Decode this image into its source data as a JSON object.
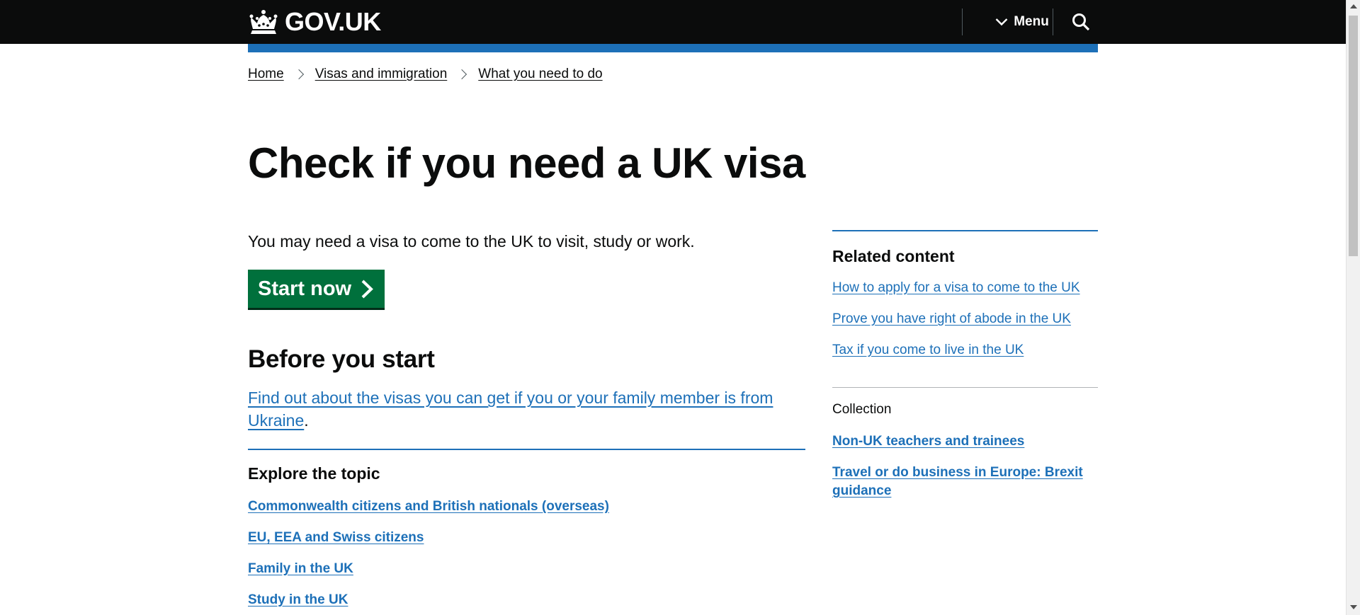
{
  "header": {
    "logo_text": "GOV.UK",
    "menu_label": "Menu",
    "colors": {
      "background": "#0b0c0c",
      "accent_bar": "#1d70b8"
    }
  },
  "breadcrumbs": [
    {
      "label": "Home"
    },
    {
      "label": "Visas and immigration"
    },
    {
      "label": "What you need to do"
    }
  ],
  "page": {
    "title": "Check if you need a UK visa",
    "intro": "You may need a visa to come to the UK to visit, study or work.",
    "start_button": "Start now",
    "start_button_color": "#00703c",
    "before_heading": "Before you start",
    "ukraine_link": "Find out about the visas you can get if you or your family member is from Ukraine",
    "ukraine_suffix": ".",
    "explore_heading": "Explore the topic",
    "topics": [
      "Commonwealth citizens and British nationals (overseas)",
      "EU, EEA and Swiss citizens",
      "Family in the UK",
      "Study in the UK"
    ]
  },
  "sidebar": {
    "related_heading": "Related content",
    "related_links": [
      "How to apply for a visa to come to the UK",
      "Prove you have right of abode in the UK",
      "Tax if you come to live in the UK"
    ],
    "collection_label": "Collection",
    "collections": [
      "Non-UK teachers and trainees",
      "Travel or do business in Europe: Brexit guidance"
    ]
  },
  "link_color": "#1d70b8"
}
